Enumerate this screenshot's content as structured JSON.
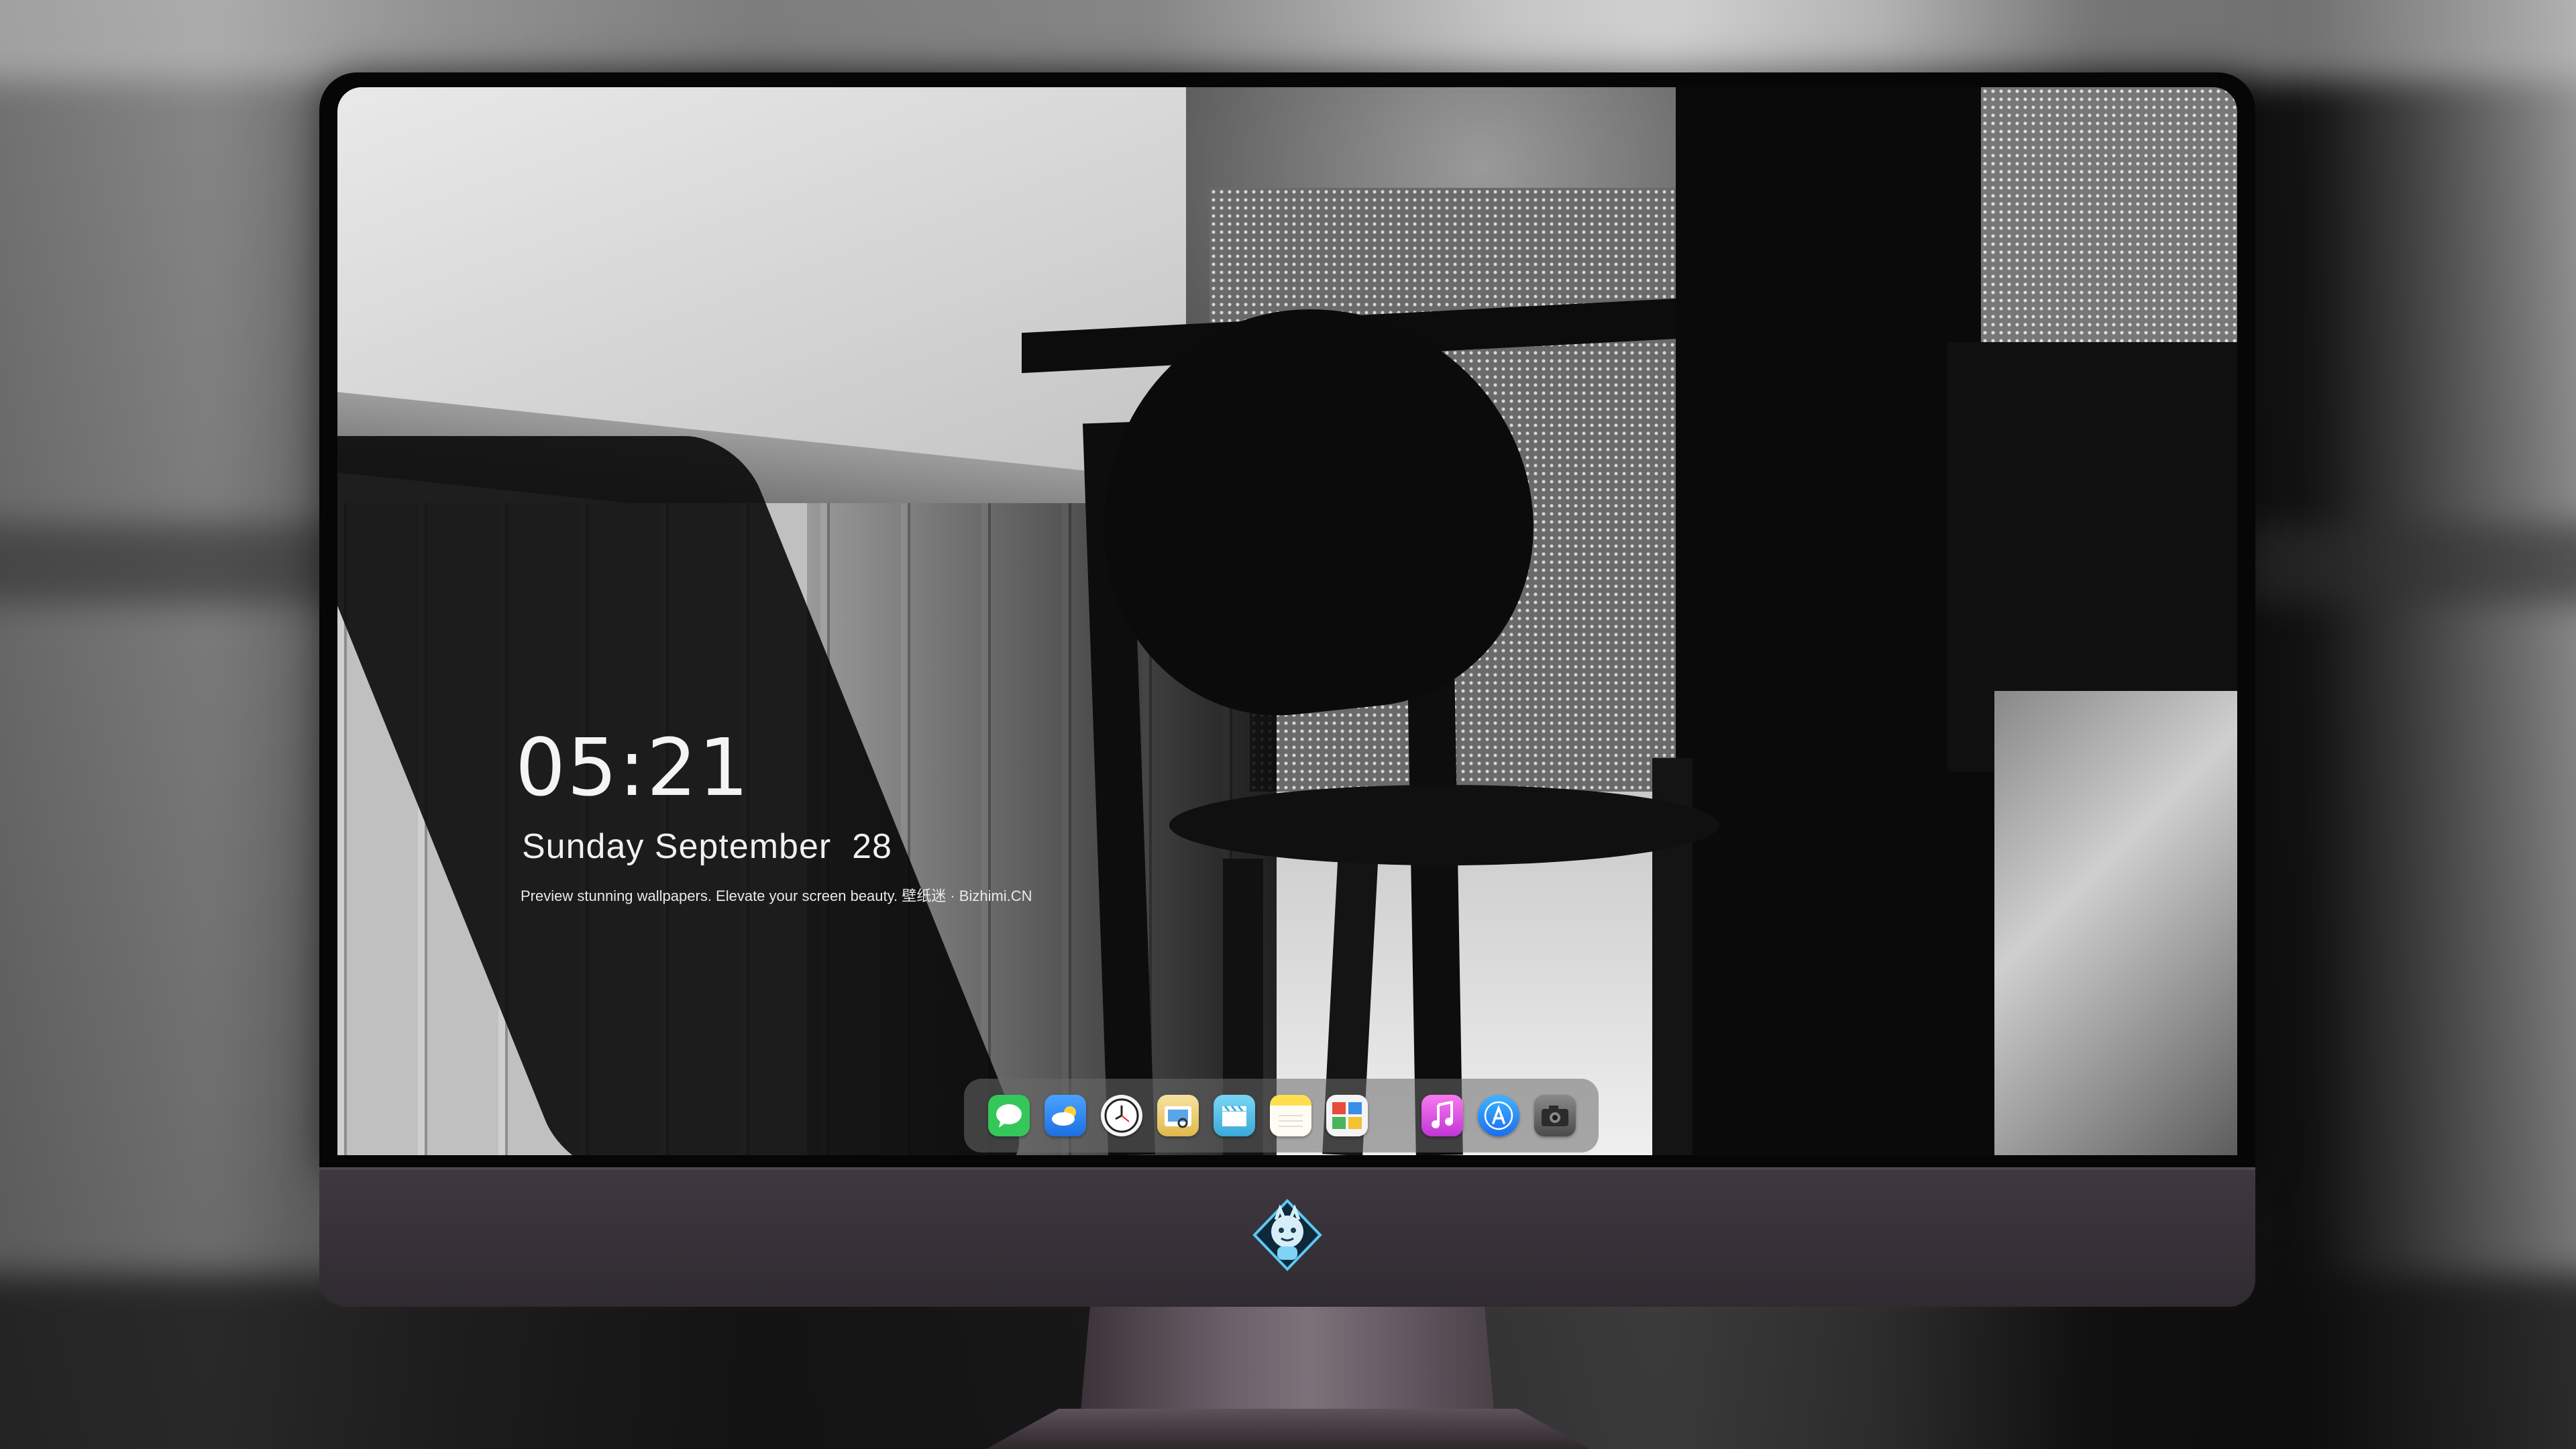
{
  "lock_screen": {
    "time": "05:21",
    "date": "Sunday September  28",
    "tagline": "Preview stunning wallpapers. Elevate your screen beauty. 壁纸迷 · Bizhimi.CN"
  },
  "dock": {
    "apps": [
      {
        "name": "Messages",
        "icon": "messages-icon",
        "glyph": "💬",
        "color": "#34c759"
      },
      {
        "name": "Weather",
        "icon": "weather-icon",
        "glyph": "☁",
        "color": "#2f8bf0"
      },
      {
        "name": "Clock",
        "icon": "clock-icon",
        "glyph": "🕘",
        "color": "#f2f2f2"
      },
      {
        "name": "Preview",
        "icon": "preview-icon",
        "glyph": "▤",
        "color": "#e8c35a"
      },
      {
        "name": "Video Editor",
        "icon": "clapper-icon",
        "glyph": "🎬",
        "color": "#5bc3e8"
      },
      {
        "name": "Notes",
        "icon": "notes-icon",
        "glyph": "☰",
        "color": "#ffd84a"
      },
      {
        "name": "Photo Booth",
        "icon": "photo-grid-icon",
        "glyph": "▦",
        "color": "#4fae5a"
      },
      {
        "name": "Music",
        "icon": "music-icon",
        "glyph": "♫",
        "color": "#e24ad6"
      },
      {
        "name": "App Store",
        "icon": "app-store-icon",
        "glyph": "Ⓐ",
        "color": "#2a86f2"
      },
      {
        "name": "Camera",
        "icon": "camera-icon",
        "glyph": "◉",
        "color": "#5d5d5d"
      }
    ]
  },
  "monitor": {
    "logo_icon": "dragon-mascot-icon",
    "chin_color": "#3a3339"
  }
}
